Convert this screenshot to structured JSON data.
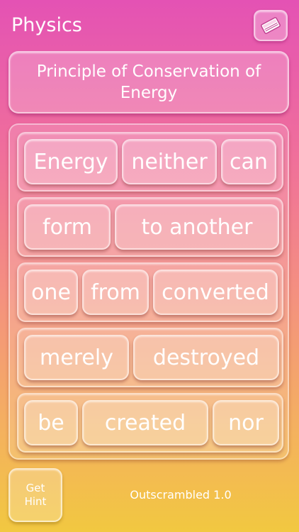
{
  "header": {
    "title": "Physics",
    "book_icon": "book-icon"
  },
  "puzzle": {
    "heading": "Principle of Conservation of Energy"
  },
  "rows": [
    {
      "tiles": [
        "Energy",
        "neither",
        "can"
      ]
    },
    {
      "tiles": [
        "form",
        "to another"
      ]
    },
    {
      "tiles": [
        "one",
        "from",
        "converted"
      ]
    },
    {
      "tiles": [
        "merely",
        "destroyed"
      ]
    },
    {
      "tiles": [
        "be",
        "created",
        "nor"
      ]
    }
  ],
  "footer": {
    "hint_label": "Get Hint",
    "version": "Outscrambled 1.0"
  }
}
